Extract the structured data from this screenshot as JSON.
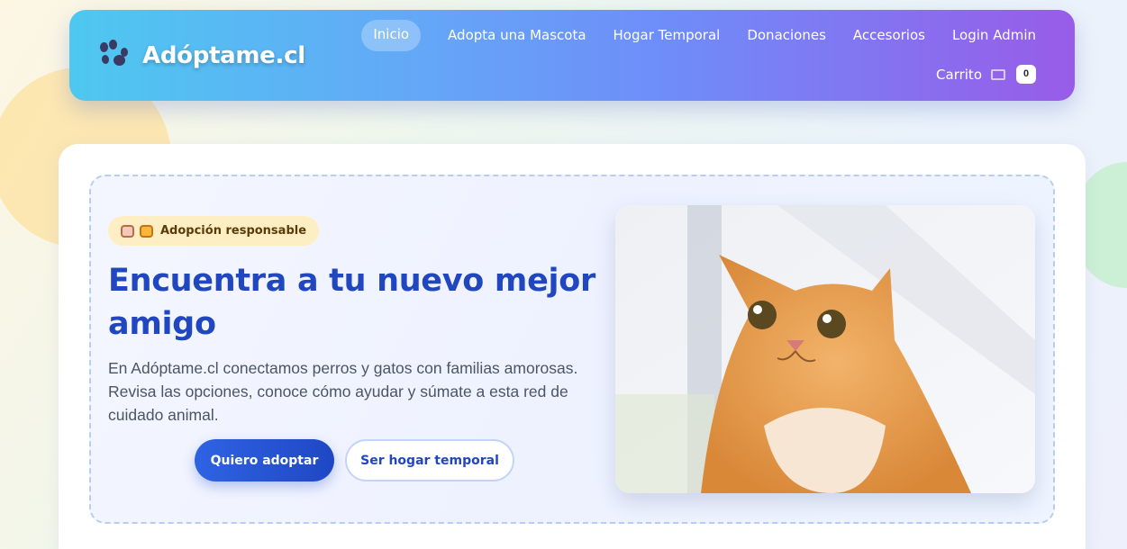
{
  "brand": {
    "title": "Adóptame.cl",
    "icon": "paw-icon"
  },
  "nav": {
    "items": [
      {
        "label": "Inicio",
        "active": true
      },
      {
        "label": "Adopta una Mascota",
        "active": false
      },
      {
        "label": "Hogar Temporal",
        "active": false
      },
      {
        "label": "Donaciones",
        "active": false
      },
      {
        "label": "Accesorios",
        "active": false
      },
      {
        "label": "Login Admin",
        "active": false
      }
    ],
    "cart": {
      "label": "Carrito",
      "icon": "ticket-icon",
      "count": "0"
    }
  },
  "hero": {
    "badge": {
      "text": "Adopción responsable",
      "icons": [
        "dog-face-icon",
        "cat-face-icon"
      ]
    },
    "title": "Encuentra a tu nuevo mejor amigo",
    "description": "En Adóptame.cl conectamos perros y gatos con familias amorosas. Revisa las opciones, conoce cómo ayudar y súmate a esta red de cuidado animal.",
    "primary_button": "Quiero adoptar",
    "secondary_button": "Ser hogar temporal",
    "image": "orange-cat-photo"
  },
  "colors": {
    "nav_gradient_start": "#4ec8f0",
    "nav_gradient_end": "#985ce8",
    "title_blue": "#2147c0",
    "primary_button": "#2f63e3",
    "badge_bg": "#fdefc3"
  }
}
